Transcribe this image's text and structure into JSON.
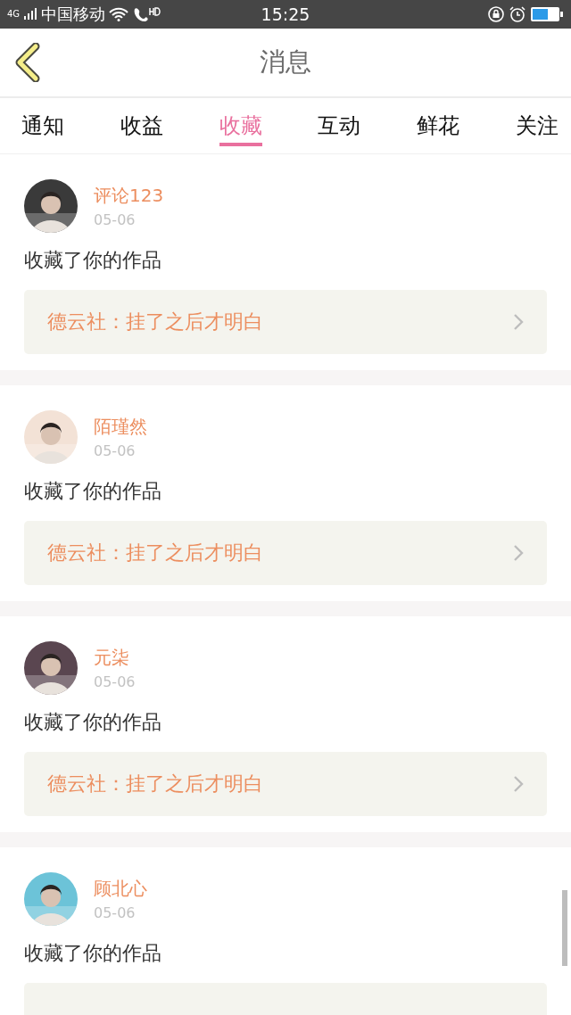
{
  "status_bar": {
    "network": "4G",
    "carrier": "中国移动",
    "time": "15:25"
  },
  "header": {
    "title": "消息"
  },
  "tabs": [
    {
      "label": "通知",
      "selected": false
    },
    {
      "label": "收益",
      "selected": false
    },
    {
      "label": "收藏",
      "selected": true
    },
    {
      "label": "互动",
      "selected": false
    },
    {
      "label": "鲜花",
      "selected": false
    },
    {
      "label": "关注",
      "selected": false
    }
  ],
  "messages": [
    {
      "user": "评论123",
      "date": "05-06",
      "action": "收藏了你的作品",
      "work": "德云社：挂了之后才明白"
    },
    {
      "user": "陌瑾然",
      "date": "05-06",
      "action": "收藏了你的作品",
      "work": "德云社：挂了之后才明白"
    },
    {
      "user": "元柒",
      "date": "05-06",
      "action": "收藏了你的作品",
      "work": "德云社：挂了之后才明白"
    },
    {
      "user": "顾北心",
      "date": "05-06",
      "action": "收藏了你的作品"
    }
  ]
}
